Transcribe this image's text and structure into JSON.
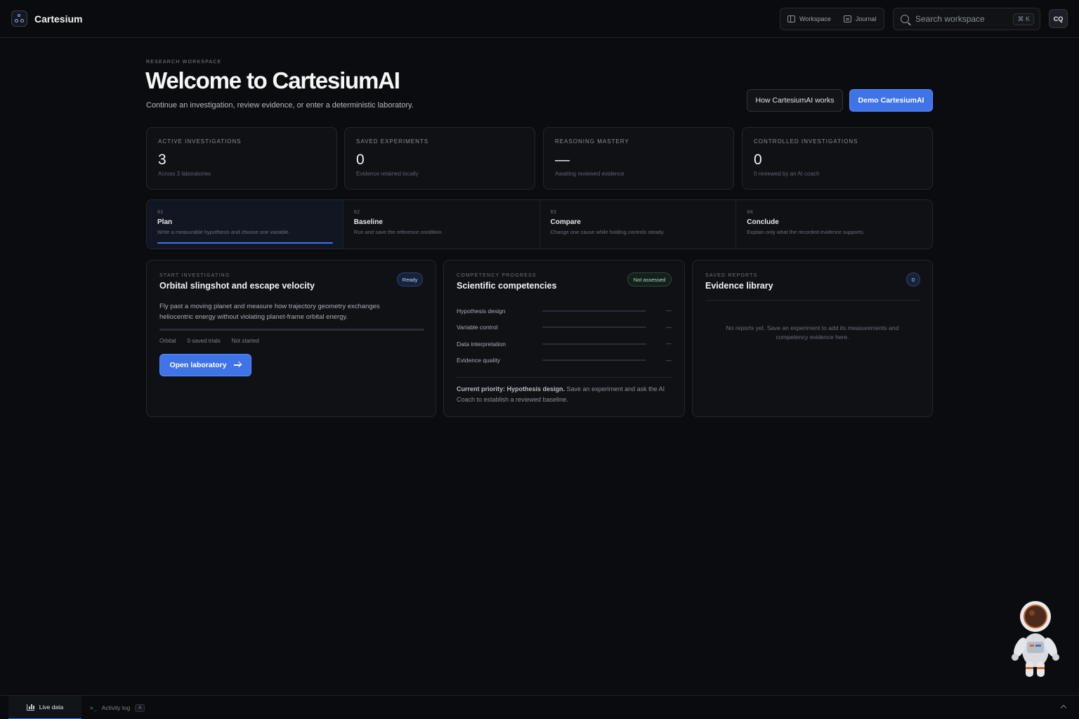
{
  "app": {
    "name": "Cartesium"
  },
  "nav": {
    "workspace": "Workspace",
    "journal": "Journal"
  },
  "search": {
    "placeholder": "Search workspace",
    "shortcut": "⌘ K"
  },
  "user": {
    "initials": "CQ"
  },
  "header": {
    "eyebrow": "RESEARCH WORKSPACE",
    "title": "Welcome to CartesiumAI",
    "subtitle": "Continue an investigation, review evidence, or enter a deterministic laboratory.",
    "secondary_button": "How CartesiumAI works",
    "primary_button": "Demo CartesiumAI"
  },
  "stats": [
    {
      "label": "ACTIVE INVESTIGATIONS",
      "value": "3",
      "caption": "Across 3 laboratories"
    },
    {
      "label": "SAVED EXPERIMENTS",
      "value": "0",
      "caption": "Evidence retained locally"
    },
    {
      "label": "REASONING MASTERY",
      "value": "—",
      "caption": "Awaiting reviewed evidence"
    },
    {
      "label": "CONTROLLED INVESTIGATIONS",
      "value": "0",
      "caption": "0 reviewed by an AI coach"
    }
  ],
  "steps": [
    {
      "num": "01",
      "title": "Plan",
      "desc": "Write a measurable hypothesis and choose one variable."
    },
    {
      "num": "02",
      "title": "Baseline",
      "desc": "Run and save the reference condition."
    },
    {
      "num": "03",
      "title": "Compare",
      "desc": "Change one cause while holding controls steady."
    },
    {
      "num": "04",
      "title": "Conclude",
      "desc": "Explain only what the recorded evidence supports."
    }
  ],
  "investigation": {
    "eyebrow": "START INVESTIGATING",
    "title": "Orbital slingshot and escape velocity",
    "badge": "Ready",
    "description": "Fly past a moving planet and measure how trajectory geometry exchanges heliocentric energy without violating planet-frame orbital energy.",
    "meta": [
      "Orbital",
      "0 saved trials",
      "Not started"
    ],
    "button": "Open laboratory"
  },
  "competencies": {
    "eyebrow": "COMPETENCY PROGRESS",
    "title": "Scientific competencies",
    "badge": "Not assessed",
    "items": [
      {
        "name": "Hypothesis design",
        "value": "—"
      },
      {
        "name": "Variable control",
        "value": "—"
      },
      {
        "name": "Data interpretation",
        "value": "—"
      },
      {
        "name": "Evidence quality",
        "value": "—"
      }
    ],
    "priority_label": "Current priority: Hypothesis design.",
    "priority_text": "Save an experiment and ask the AI Coach to establish a reviewed baseline."
  },
  "reports": {
    "eyebrow": "SAVED REPORTS",
    "title": "Evidence library",
    "count": "0",
    "empty": "No reports yet. Save an experiment to add its measurements and competency evidence here."
  },
  "bottom": {
    "live": "Live data",
    "log": "Activity log",
    "log_count": "4"
  },
  "colors": {
    "accent": "#3f74e8",
    "background": "#0b0c0f",
    "panel": "#0f1115"
  }
}
